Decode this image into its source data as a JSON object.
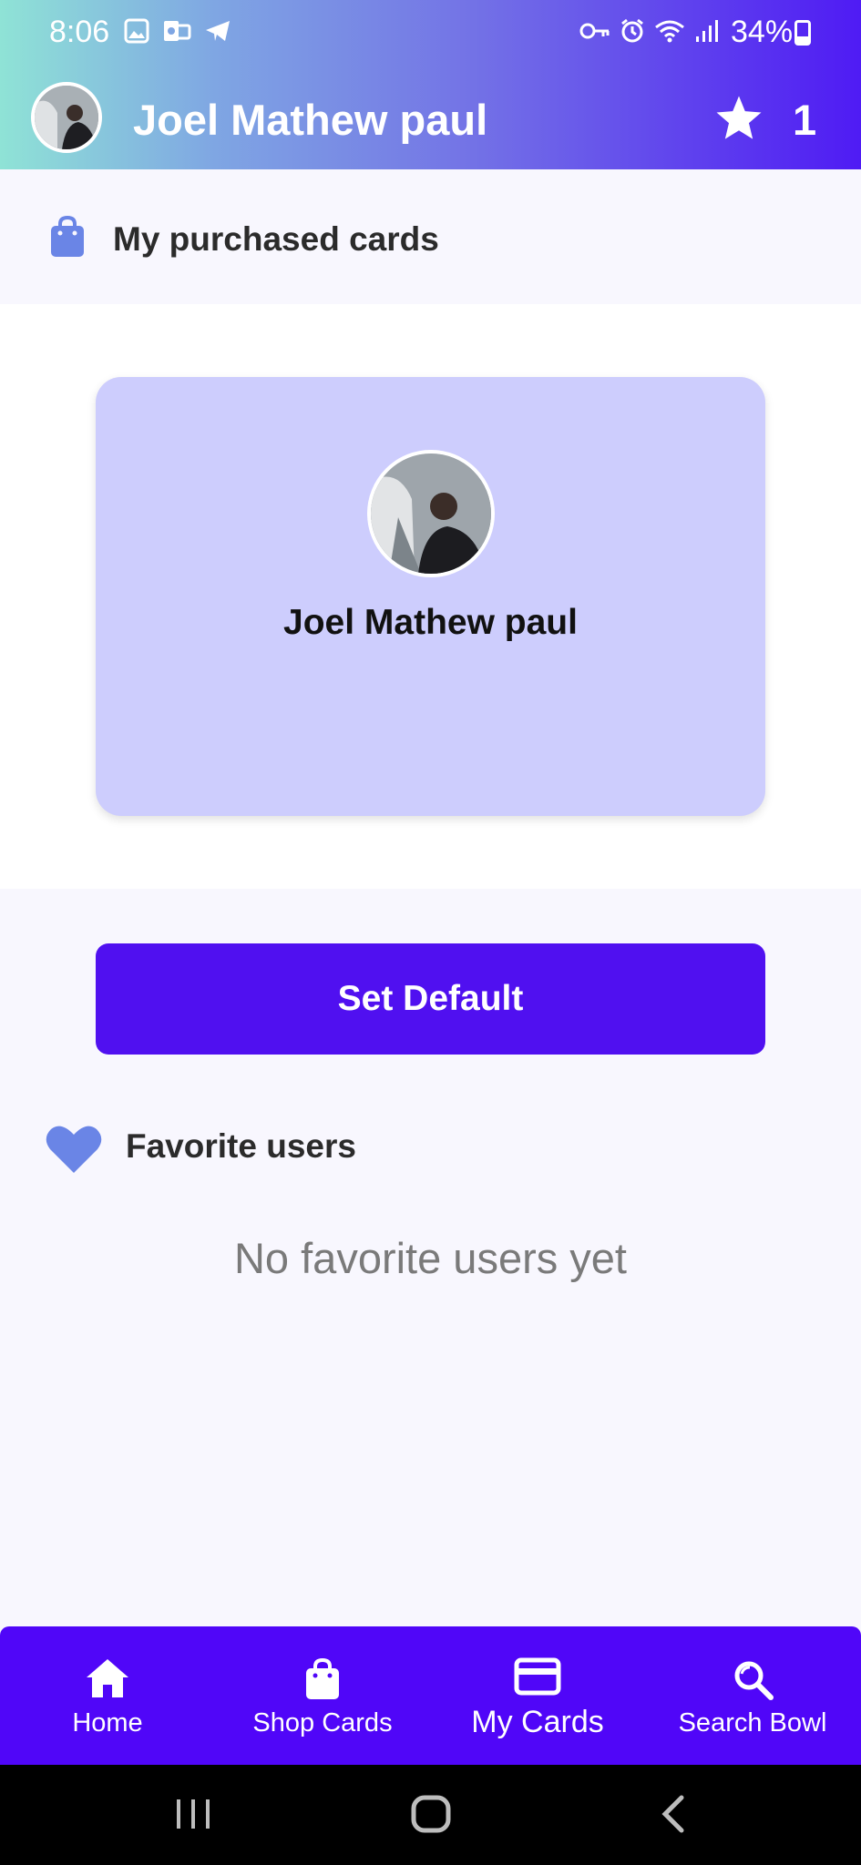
{
  "status_bar": {
    "time": "8:06",
    "battery": "34%",
    "battery_level": 0.34
  },
  "header": {
    "user_name": "Joel Mathew paul",
    "star_count": "1"
  },
  "purchased": {
    "title": "My purchased cards",
    "icon": "shopping-bag-icon"
  },
  "card": {
    "name": "Joel Mathew paul"
  },
  "actions": {
    "set_default_label": "Set Default"
  },
  "favorites": {
    "title": "Favorite users",
    "empty_message": "No favorite users yet"
  },
  "bottom_nav": {
    "items": [
      {
        "label": "Home",
        "icon": "home-icon"
      },
      {
        "label": "Shop Cards",
        "icon": "shopping-bag-icon"
      },
      {
        "label": "My Cards",
        "icon": "credit-card-icon",
        "active": true
      },
      {
        "label": "Search Bowl",
        "icon": "search-icon"
      }
    ]
  },
  "colors": {
    "accent": "#5010f0",
    "card_bg": "#cdcdfd",
    "icon_blue": "#6a85e6"
  }
}
